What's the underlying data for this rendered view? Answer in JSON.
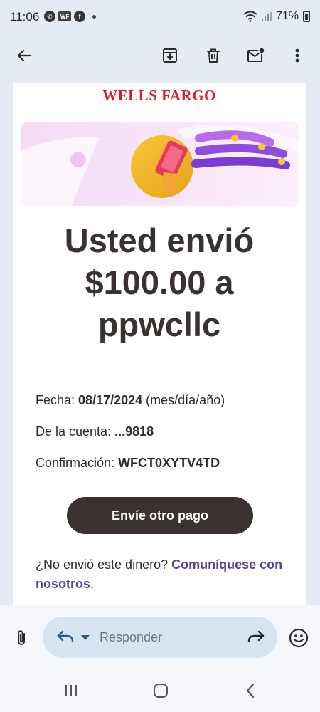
{
  "status_bar": {
    "time": "11:06",
    "notification_icons": [
      "whatsapp-icon",
      "wf-app-icon",
      "facebook-icon",
      "more-dot-icon"
    ],
    "wf_icon_text": "WF",
    "battery": "71%"
  },
  "toolbar": {
    "actions": [
      "back",
      "archive",
      "delete",
      "mark-unread",
      "more"
    ]
  },
  "email": {
    "brand": "WELLS FARGO",
    "headline_lines": [
      "Usted envió",
      "$100.00 a",
      "ppwcllc"
    ],
    "details": {
      "date_label": "Fecha:",
      "date_value": "08/17/2024",
      "date_format": "(mes/día/año)",
      "account_label": "De la cuenta:",
      "account_value": "...9818",
      "confirmation_label": "Confirmación:",
      "confirmation_value": "WFCT0XYTV4TD"
    },
    "cta_label": "Envíe otro pago",
    "footer_question": "¿No envió este dinero?",
    "footer_link": "Comuníquese con nosotros",
    "footer_end": "."
  },
  "reply_bar": {
    "placeholder": "Responder"
  },
  "colors": {
    "brand_red": "#d71e28",
    "headline": "#3a3230",
    "link": "#5a4290",
    "reply_pill": "#d7e5f3"
  }
}
